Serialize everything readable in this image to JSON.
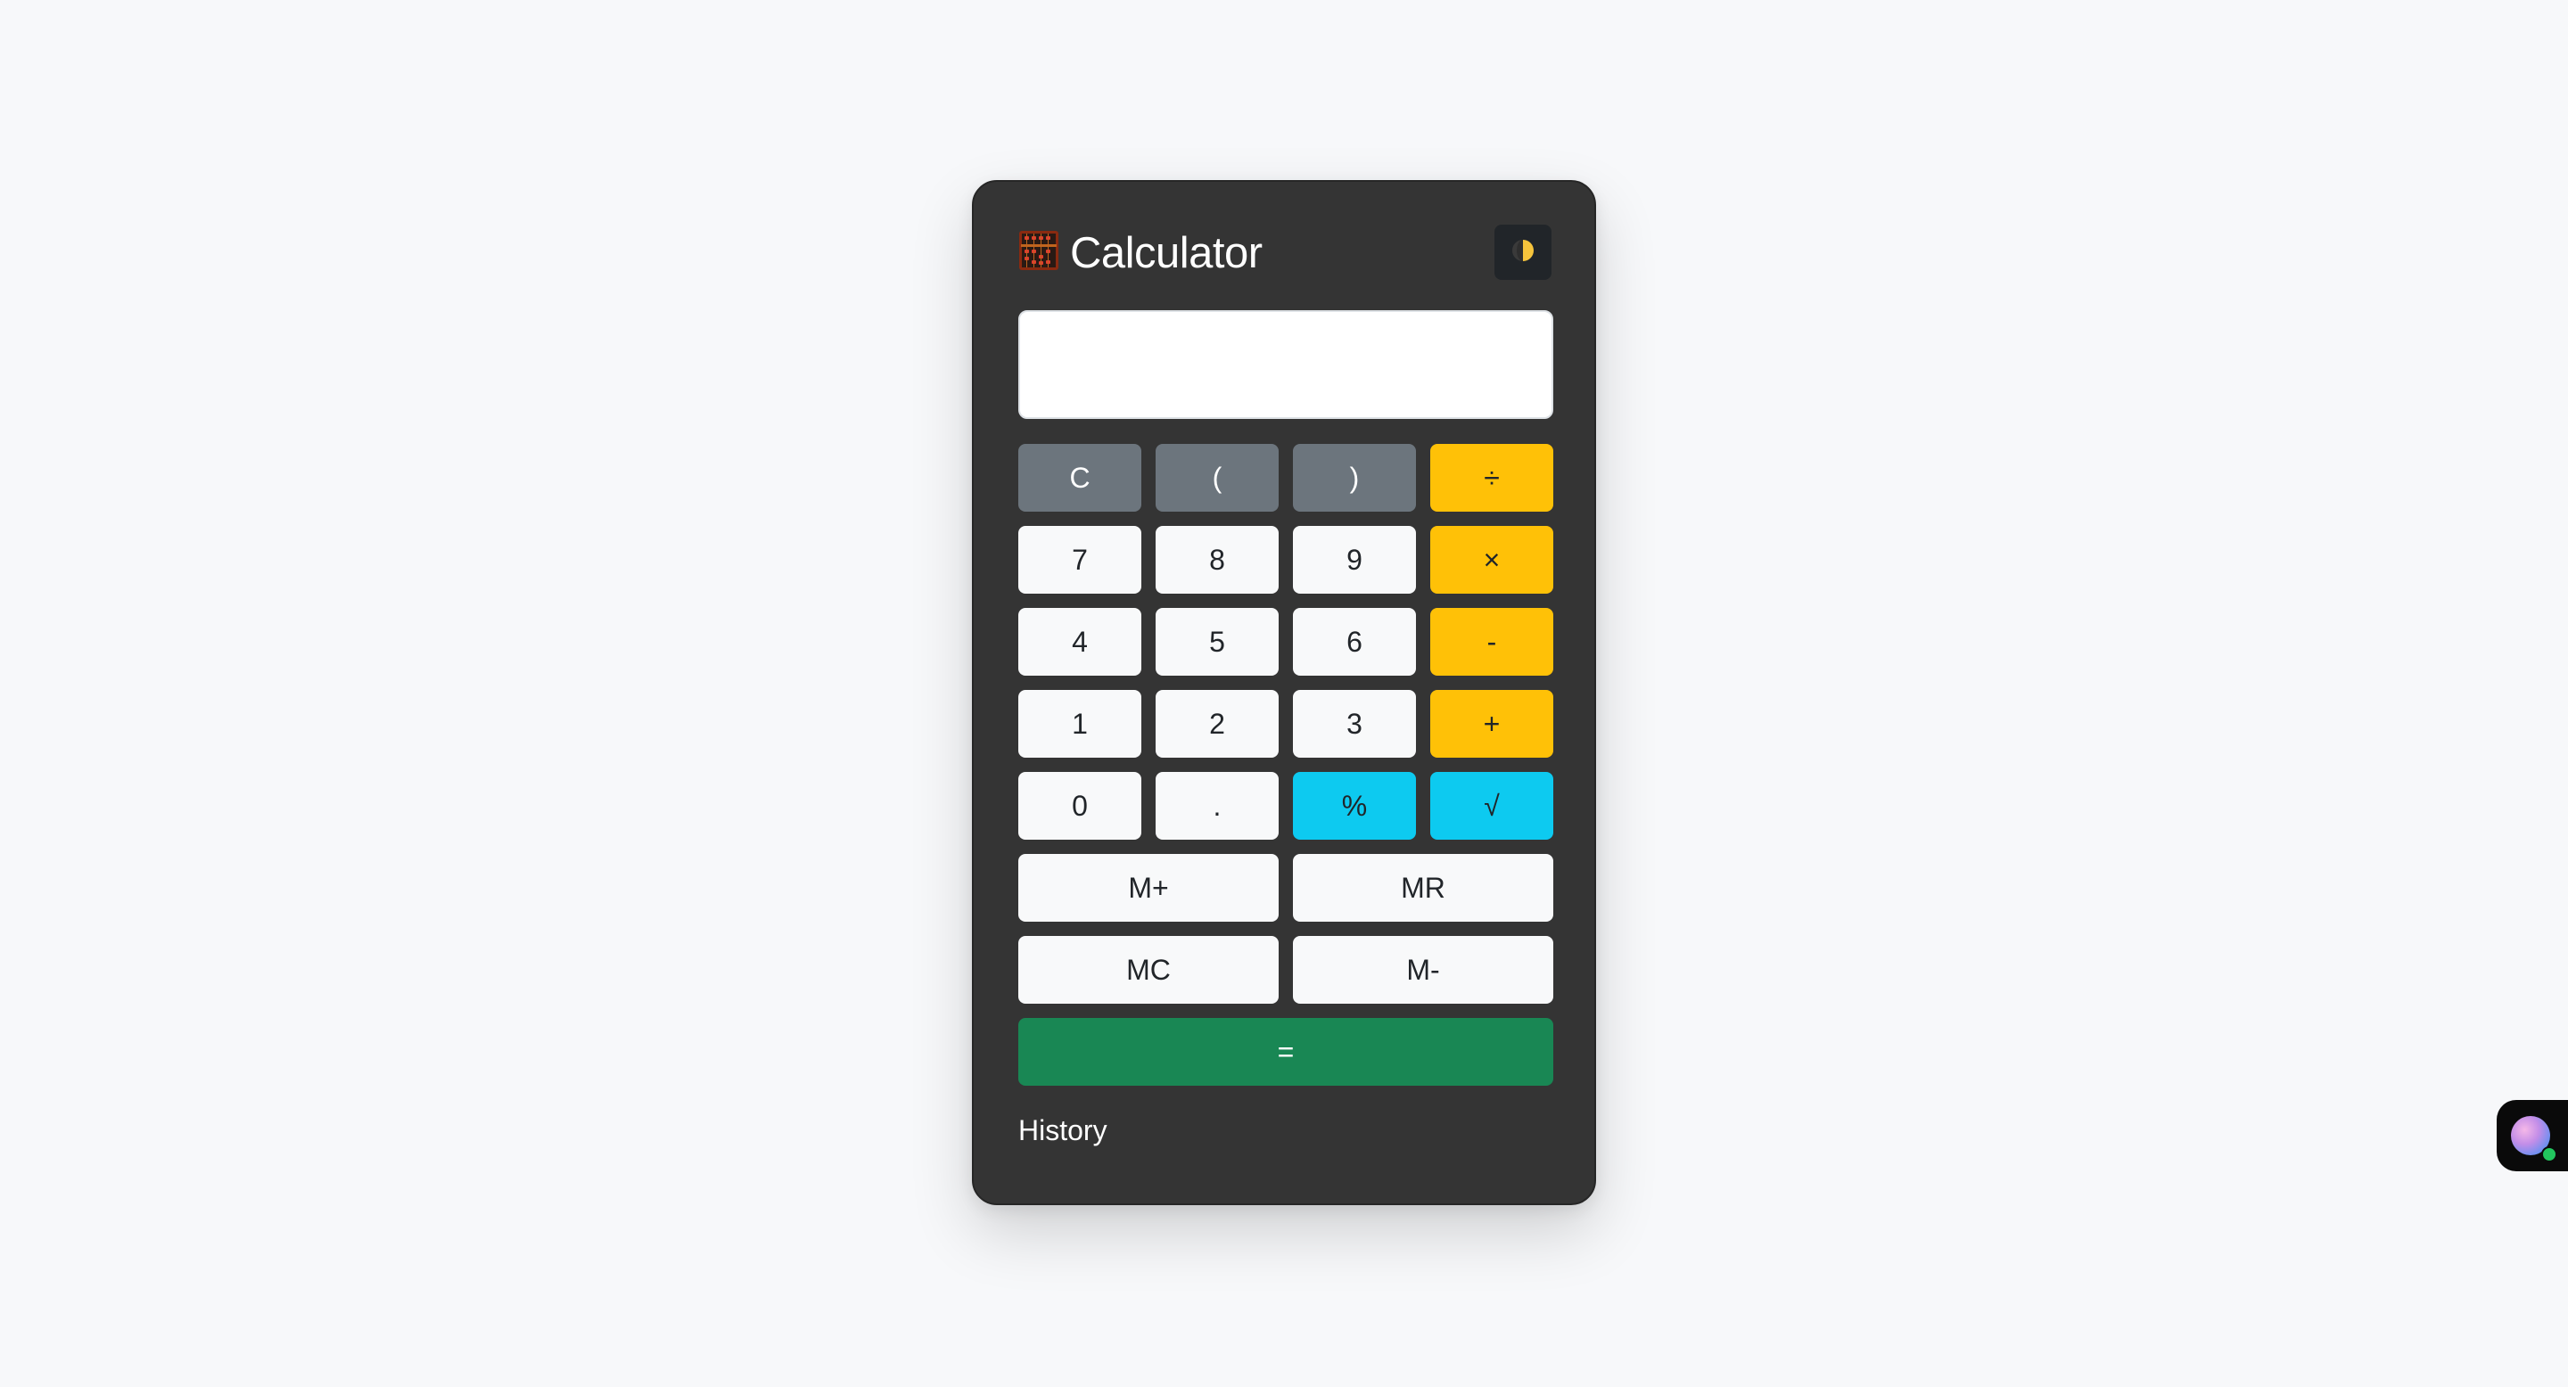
{
  "app": {
    "title": "Calculator"
  },
  "display": {
    "value": ""
  },
  "keys": [
    {
      "label": "C",
      "name": "clear-button",
      "variant": "gray"
    },
    {
      "label": "(",
      "name": "open-paren-button",
      "variant": "gray"
    },
    {
      "label": ")",
      "name": "close-paren-button",
      "variant": "gray"
    },
    {
      "label": "÷",
      "name": "divide-button",
      "variant": "warn"
    },
    {
      "label": "7",
      "name": "digit-7-button",
      "variant": "light"
    },
    {
      "label": "8",
      "name": "digit-8-button",
      "variant": "light"
    },
    {
      "label": "9",
      "name": "digit-9-button",
      "variant": "light"
    },
    {
      "label": "×",
      "name": "multiply-button",
      "variant": "warn"
    },
    {
      "label": "4",
      "name": "digit-4-button",
      "variant": "light"
    },
    {
      "label": "5",
      "name": "digit-5-button",
      "variant": "light"
    },
    {
      "label": "6",
      "name": "digit-6-button",
      "variant": "light"
    },
    {
      "label": "-",
      "name": "subtract-button",
      "variant": "warn"
    },
    {
      "label": "1",
      "name": "digit-1-button",
      "variant": "light"
    },
    {
      "label": "2",
      "name": "digit-2-button",
      "variant": "light"
    },
    {
      "label": "3",
      "name": "digit-3-button",
      "variant": "light"
    },
    {
      "label": "+",
      "name": "add-button",
      "variant": "warn"
    },
    {
      "label": "0",
      "name": "digit-0-button",
      "variant": "light"
    },
    {
      "label": ".",
      "name": "decimal-point-button",
      "variant": "light"
    },
    {
      "label": "%",
      "name": "percent-button",
      "variant": "info"
    },
    {
      "label": "√",
      "name": "square-root-button",
      "variant": "info"
    },
    {
      "label": "M+",
      "name": "memory-add-button",
      "variant": "light",
      "span": 2
    },
    {
      "label": "MR",
      "name": "memory-recall-button",
      "variant": "light",
      "span": 2
    },
    {
      "label": "MC",
      "name": "memory-clear-button",
      "variant": "light",
      "span": 2
    },
    {
      "label": "M-",
      "name": "memory-subtract-button",
      "variant": "light",
      "span": 2
    },
    {
      "label": "=",
      "name": "equals-button",
      "variant": "success",
      "span": 4
    }
  ],
  "history": {
    "label": "History"
  },
  "icons": {
    "app_icon": "abacus-icon",
    "theme_toggle": "half-moon-icon",
    "side_widget": "assistant-avatar-icon"
  },
  "colors": {
    "card_background": "#343434",
    "operator": "#ffc107",
    "function": "#0dcaf0",
    "equals": "#198754",
    "control": "#6c757d",
    "digit": "#f8f9fa"
  }
}
